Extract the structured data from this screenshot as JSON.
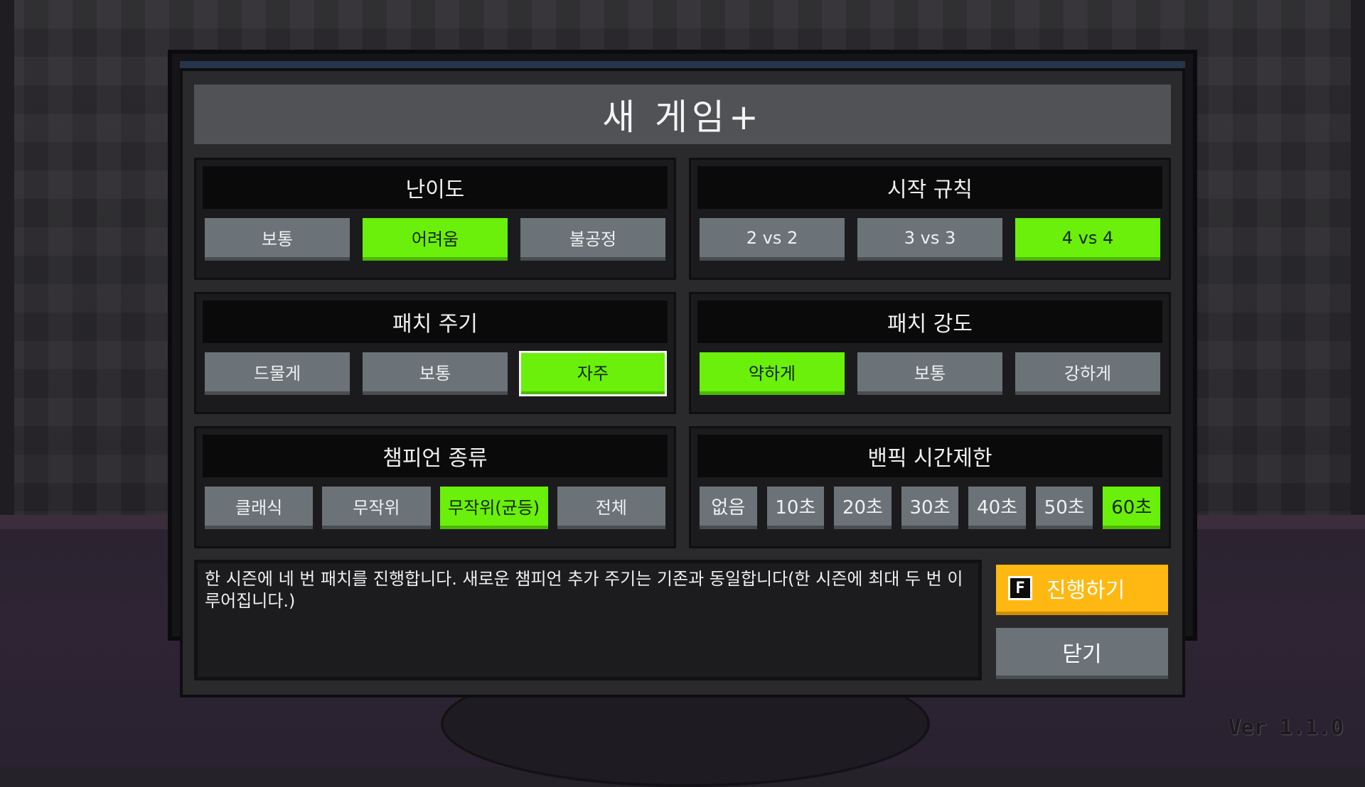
{
  "title": "새 게임+",
  "sections": {
    "difficulty": {
      "heading": "난이도",
      "options": [
        "보통",
        "어려움",
        "불공정"
      ],
      "selected": "어려움"
    },
    "start_rule": {
      "heading": "시작 규칙",
      "options": [
        "2 vs 2",
        "3 vs 3",
        "4 vs 4"
      ],
      "selected": "4 vs 4"
    },
    "patch_cycle": {
      "heading": "패치 주기",
      "options": [
        "드물게",
        "보통",
        "자주"
      ],
      "selected": "자주"
    },
    "patch_strength": {
      "heading": "패치 강도",
      "options": [
        "약하게",
        "보통",
        "강하게"
      ],
      "selected": "약하게"
    },
    "champion_type": {
      "heading": "챔피언 종류",
      "options": [
        "클래식",
        "무작위",
        "무작위(균등)",
        "전체"
      ],
      "selected": "무작위(균등)"
    },
    "banpick_time": {
      "heading": "밴픽 시간제한",
      "options": [
        "없음",
        "10초",
        "20초",
        "30초",
        "40초",
        "50초",
        "60초"
      ],
      "selected": "60초"
    }
  },
  "description": "한 시즌에 네 번 패치를 진행합니다. 새로운 챔피언 추가 주기는 기존과 동일합니다(한 시즌에 최대 두 번 이루어집니다.)",
  "actions": {
    "proceed_key": "F",
    "proceed_label": "진행하기",
    "close_label": "닫기"
  },
  "version": "Ver 1.1.0",
  "colors": {
    "selected": "#6af00a",
    "option": "#6c7378",
    "proceed": "#ffb812"
  }
}
